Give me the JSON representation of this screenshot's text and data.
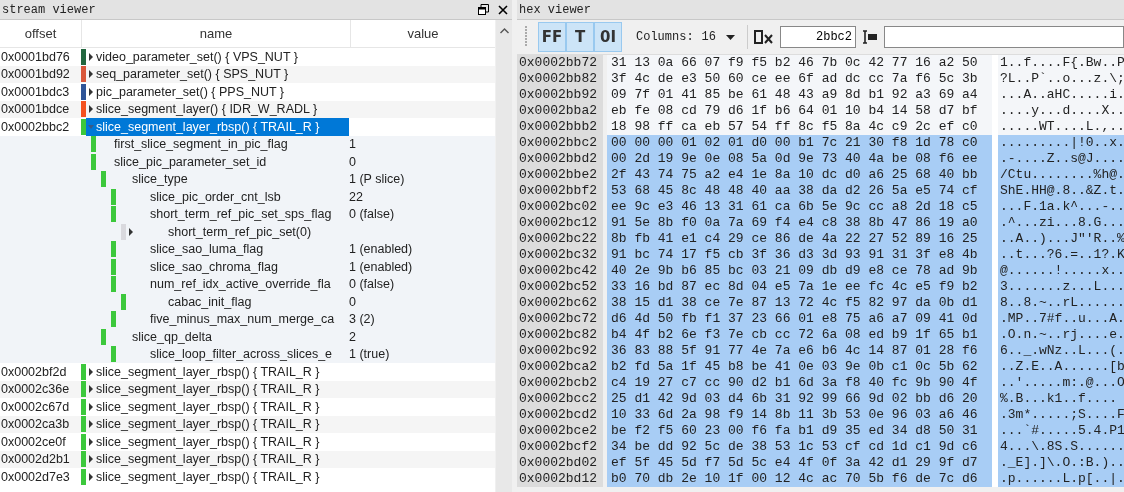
{
  "stream_viewer": {
    "title": "stream viewer",
    "columns": [
      "offset",
      "name",
      "value"
    ],
    "rows": [
      {
        "offset": "0x0001bd76",
        "name": "video_parameter_set() { VPS_NUT }",
        "color": "#23673f",
        "expanded": false,
        "selected": false
      },
      {
        "offset": "0x0001bd92",
        "name": "seq_parameter_set() { SPS_NUT }",
        "color": "#d9573a",
        "expanded": false,
        "selected": false
      },
      {
        "offset": "0x0001bdc3",
        "name": "pic_parameter_set() { PPS_NUT }",
        "color": "#2f5597",
        "expanded": false,
        "selected": false
      },
      {
        "offset": "0x0001bdce",
        "name": "slice_segment_layer() { IDR_W_RADL }",
        "color": "#f4511e",
        "expanded": false,
        "selected": false
      },
      {
        "offset": "0x0002bbc2",
        "name": "slice_segment_layer_rbsp() { TRAIL_R }",
        "color": "#3cc83c",
        "expanded": true,
        "selected": true,
        "children": [
          {
            "name": "first_slice_segment_in_pic_flag",
            "value": "1",
            "color": "#3cc83c"
          },
          {
            "name": "slice_pic_parameter_set_id",
            "value": "0",
            "color": "#3cc83c",
            "children": [
              {
                "name": "slice_type",
                "value": "1 (P slice)",
                "color": "#3cc83c",
                "children": [
                  {
                    "name": "slice_pic_order_cnt_lsb",
                    "value": "22",
                    "color": "#3cc83c"
                  },
                  {
                    "name": "short_term_ref_pic_set_sps_flag",
                    "value": "0 (false)",
                    "color": "#3cc83c",
                    "children": [
                      {
                        "name": "short_term_ref_pic_set(0)",
                        "color": "#d9d9de",
                        "expanded": false
                      }
                    ]
                  },
                  {
                    "name": "slice_sao_luma_flag",
                    "value": "1 (enabled)",
                    "color": "#3cc83c"
                  },
                  {
                    "name": "slice_sao_chroma_flag",
                    "value": "1 (enabled)",
                    "color": "#3cc83c"
                  },
                  {
                    "name": "num_ref_idx_active_override_fla",
                    "value": "0 (false)",
                    "color": "#3cc83c",
                    "children": [
                      {
                        "name": "cabac_init_flag",
                        "value": "0",
                        "color": "#3cc83c"
                      }
                    ]
                  },
                  {
                    "name": "five_minus_max_num_merge_ca",
                    "value": "3 (2)",
                    "color": "#3cc83c"
                  }
                ]
              },
              {
                "name": "slice_qp_delta",
                "value": "2",
                "color": "#3cc83c",
                "children": [
                  {
                    "name": "slice_loop_filter_across_slices_e",
                    "value": "1 (true)",
                    "color": "#3cc83c"
                  }
                ]
              }
            ]
          }
        ]
      },
      {
        "offset": "0x0002bf2d",
        "name": "slice_segment_layer_rbsp() { TRAIL_R }",
        "color": "#3cc83c",
        "expanded": false,
        "selected": false
      },
      {
        "offset": "0x0002c36e",
        "name": "slice_segment_layer_rbsp() { TRAIL_R }",
        "color": "#3cc83c",
        "expanded": false,
        "selected": false
      },
      {
        "offset": "0x0002c67d",
        "name": "slice_segment_layer_rbsp() { TRAIL_R }",
        "color": "#3cc83c",
        "expanded": false,
        "selected": false
      },
      {
        "offset": "0x0002ca3b",
        "name": "slice_segment_layer_rbsp() { TRAIL_R }",
        "color": "#3cc83c",
        "expanded": false,
        "selected": false
      },
      {
        "offset": "0x0002ce0f",
        "name": "slice_segment_layer_rbsp() { TRAIL_R }",
        "color": "#3cc83c",
        "expanded": false,
        "selected": false
      },
      {
        "offset": "0x0002d2b1",
        "name": "slice_segment_layer_rbsp() { TRAIL_R }",
        "color": "#3cc83c",
        "expanded": false,
        "selected": false
      },
      {
        "offset": "0x0002d7e3",
        "name": "slice_segment_layer_rbsp() { TRAIL_R }",
        "color": "#3cc83c",
        "expanded": false,
        "selected": false
      }
    ]
  },
  "hex_viewer": {
    "title": "hex viewer",
    "view_buttons": [
      {
        "label": "FF",
        "selected": true
      },
      {
        "label": "T",
        "selected": true
      },
      {
        "label": "0I",
        "selected": true
      }
    ],
    "columns_label": "Columns:",
    "columns_value": "16",
    "offset_value": "2bbc2",
    "rows": [
      {
        "offset": "0x0002bb72",
        "hex": "31 13 0a 66 07 f9 f5 b2 46 7b 0c 42 77 16 a2 50",
        "ascii": "1..f....F{.Bw..P",
        "selected": false
      },
      {
        "offset": "0x0002bb82",
        "hex": "3f 4c de e3 50 60 ce ee 6f ad dc cc 7a f6 5c 3b",
        "ascii": "?L..P`..o...z.\\;",
        "selected": false
      },
      {
        "offset": "0x0002bb92",
        "hex": "09 7f 01 41 85 be 61 48 43 a9 8d b1 92 a3 69 a4",
        "ascii": "...A..aHC.....i.",
        "selected": false
      },
      {
        "offset": "0x0002bba2",
        "hex": "eb fe 08 cd 79 d6 1f b6 64 01 10 b4 14 58 d7 bf",
        "ascii": "....y...d....X..",
        "selected": false
      },
      {
        "offset": "0x0002bbb2",
        "hex": "18 98 ff ca eb 57 54 ff 8c f5 8a 4c c9 2c ef c0",
        "ascii": ".....WT....L.,..",
        "selected": false
      },
      {
        "offset": "0x0002bbc2",
        "hex": "00 00 00 01 02 01 d0 00 b1 7c 21 30 f8 1d 78 c0",
        "ascii": ".........|!0..x.",
        "selected": true
      },
      {
        "offset": "0x0002bbd2",
        "hex": "00 2d 19 9e 0e 08 5a 0d 9e 73 40 4a be 08 f6 ee",
        "ascii": ".-....Z..s@J....",
        "selected": true
      },
      {
        "offset": "0x0002bbe2",
        "hex": "2f 43 74 75 a2 e4 1e 8a 10 dc d0 a6 25 68 40 bb",
        "ascii": "/Ctu........%h@.",
        "selected": true
      },
      {
        "offset": "0x0002bbf2",
        "hex": "53 68 45 8c 48 48 40 aa 38 da d2 26 5a e5 74 cf",
        "ascii": "ShE.HH@.8..&Z.t.",
        "selected": true
      },
      {
        "offset": "0x0002bc02",
        "hex": "ee 9c e3 46 13 31 61 ca 6b 5e 9c cc a8 2d 18 c5",
        "ascii": "...F.1a.k^...-..",
        "selected": true
      },
      {
        "offset": "0x0002bc12",
        "hex": "91 5e 8b f0 0a 7a 69 f4 e4 c8 38 8b 47 86 19 a0",
        "ascii": ".^...zi...8.G...",
        "selected": true
      },
      {
        "offset": "0x0002bc22",
        "hex": "8b fb 41 e1 c4 29 ce 86 de 4a 22 27 52 89 16 25",
        "ascii": "..A..)...J\"'R..%",
        "selected": true
      },
      {
        "offset": "0x0002bc32",
        "hex": "91 bc 74 17 f5 cb 3f 36 d3 3d 93 91 31 3f e8 4b",
        "ascii": "..t...?6.=..1?.K",
        "selected": true
      },
      {
        "offset": "0x0002bc42",
        "hex": "40 2e 9b b6 85 bc 03 21 09 db d9 e8 ce 78 ad 9b",
        "ascii": "@......!.....x..",
        "selected": true
      },
      {
        "offset": "0x0002bc52",
        "hex": "33 16 bd 87 ec 8d 04 e5 7a 1e ee fc 4c e5 f9 b2",
        "ascii": "3.......z...L...",
        "selected": true
      },
      {
        "offset": "0x0002bc62",
        "hex": "38 15 d1 38 ce 7e 87 13 72 4c f5 82 97 da 0b d1",
        "ascii": "8..8.~..rL......",
        "selected": true
      },
      {
        "offset": "0x0002bc72",
        "hex": "d6 4d 50 fb f1 37 23 66 01 e8 75 a6 a7 09 41 0d",
        "ascii": ".MP..7#f..u...A.",
        "selected": true
      },
      {
        "offset": "0x0002bc82",
        "hex": "b4 4f b2 6e f3 7e cb cc 72 6a 08 ed b9 1f 65 b1",
        "ascii": ".O.n.~..rj....e.",
        "selected": true
      },
      {
        "offset": "0x0002bc92",
        "hex": "36 83 88 5f 91 77 4e 7a e6 b6 4c 14 87 01 28 f6",
        "ascii": "6.._.wNz..L...(.",
        "selected": true
      },
      {
        "offset": "0x0002bca2",
        "hex": "b2 fd 5a 1f 45 b8 be 41 0e 03 9e 0b c1 0c 5b 62",
        "ascii": "..Z.E..A......[b",
        "selected": true
      },
      {
        "offset": "0x0002bcb2",
        "hex": "c4 19 27 c7 cc 90 d2 b1 6d 3a f8 40 fc 9b 90 4f",
        "ascii": "..'.....m:.@...O",
        "selected": true
      },
      {
        "offset": "0x0002bcc2",
        "hex": "25 d1 42 9d 03 d4 6b 31 92 99 66 9d 02 bb d6 20",
        "ascii": "%.B...k1..f.... ",
        "selected": true
      },
      {
        "offset": "0x0002bcd2",
        "hex": "10 33 6d 2a 98 f9 14 8b 11 3b 53 0e 96 03 a6 46",
        "ascii": ".3m*.....;S....F",
        "selected": true
      },
      {
        "offset": "0x0002bce2",
        "hex": "be f2 f5 60 23 00 f6 fa b1 d9 35 ed 34 d8 50 31",
        "ascii": "...`#.....5.4.P1",
        "selected": true
      },
      {
        "offset": "0x0002bcf2",
        "hex": "34 be dd 92 5c de 38 53 1c 53 cf cd 1d c1 9d c6",
        "ascii": "4...\\.8S.S......",
        "selected": true
      },
      {
        "offset": "0x0002bd02",
        "hex": "ef 5f 45 5d f7 5d 5c e4 4f 0f 3a 42 d1 29 9f d7",
        "ascii": "._E].]\\.O.:B.)..",
        "selected": true
      },
      {
        "offset": "0x0002bd12",
        "hex": "b0 70 db 2e 10 1f 00 12 4c ac 70 5b f6 de 7c d6",
        "ascii": ".p......L.p[..|.",
        "selected": true
      }
    ]
  }
}
